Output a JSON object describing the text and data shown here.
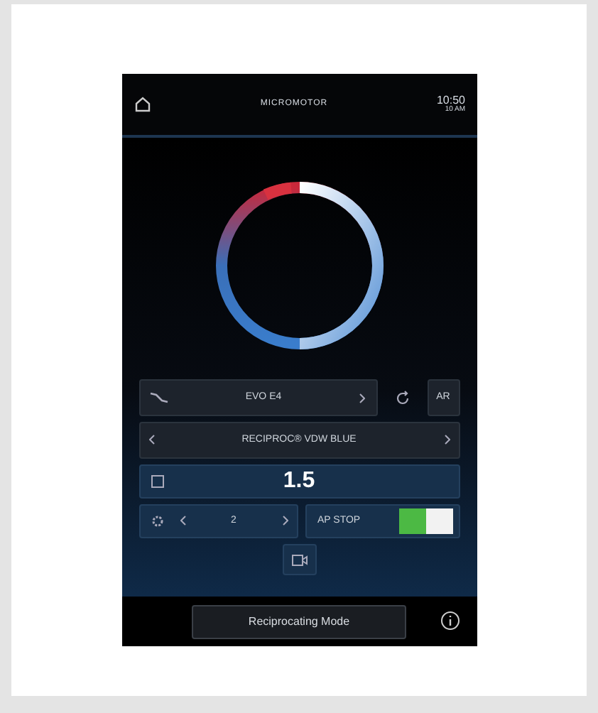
{
  "header": {
    "title": "MICROMOTOR",
    "time": "10:50",
    "period": "10 AM"
  },
  "motor": {
    "label": "EVO E4",
    "mode_button": "AR"
  },
  "file": {
    "label": "RECIPROC® VDW BLUE"
  },
  "value": "1.5",
  "setting": {
    "value": "2"
  },
  "ap_stop": {
    "label": "AP STOP",
    "on": true
  },
  "bottom": {
    "mode_button": "Reciprocating Mode"
  }
}
